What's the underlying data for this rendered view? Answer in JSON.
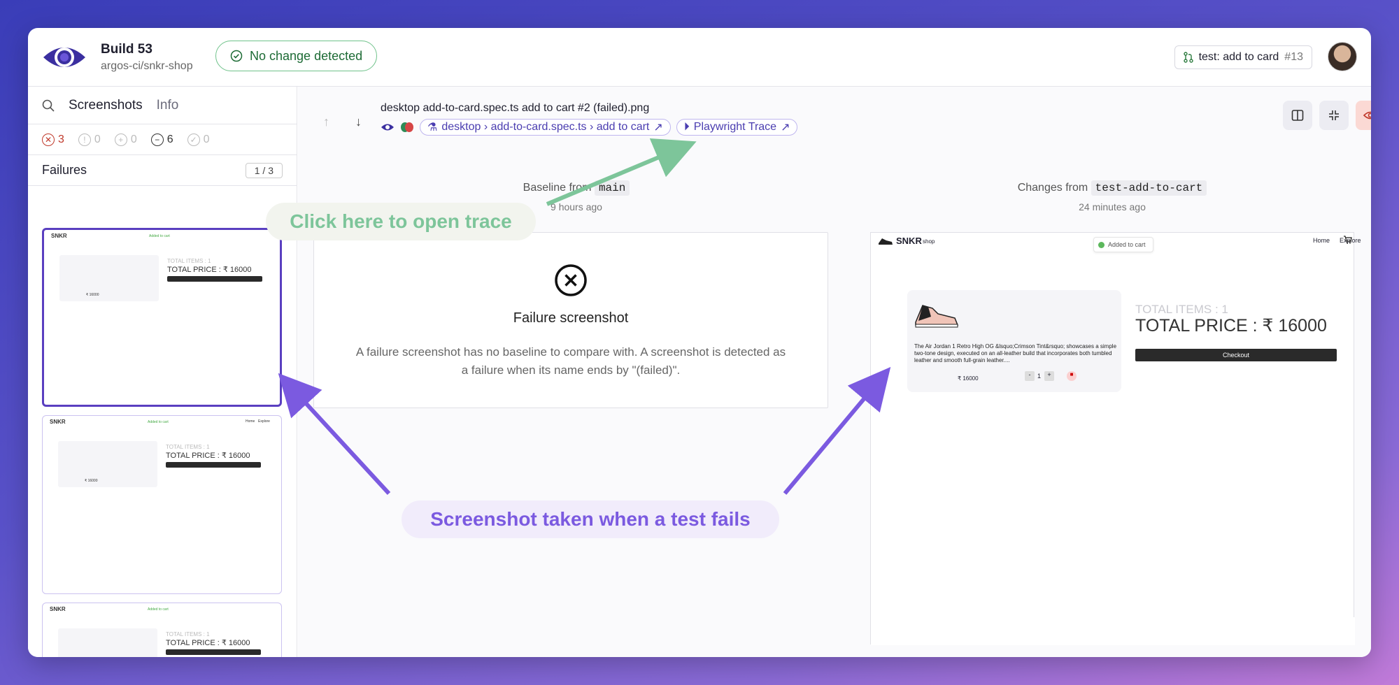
{
  "header": {
    "build_title": "Build 53",
    "repo": "argos-ci/snkr-shop",
    "status_label": "No change detected",
    "branch_label": "test: add to card",
    "pr_number": "#13"
  },
  "sidebar": {
    "tabs": [
      "Screenshots",
      "Info"
    ],
    "counts": {
      "failed": "3",
      "warning": "0",
      "added": "0",
      "unchanged": "6",
      "ok": "0"
    },
    "section_title": "Failures",
    "pager": "1 / 3",
    "thumb": {
      "brand": "SNKR",
      "brand_suffix": "shop",
      "toast": "Added to cart",
      "nav_home": "Home",
      "nav_explore": "Explore",
      "items": "TOTAL ITEMS : 1",
      "price": "TOTAL PRICE : ₹ 16000",
      "checkout": "Checkout",
      "product_price": "₹ 16000"
    }
  },
  "main": {
    "filename": "desktop add-to-card.spec.ts add to cart #2 (failed).png",
    "test_path": "desktop › add-to-card.spec.ts › add to cart",
    "trace_label": "Playwright Trace",
    "baseline": {
      "label": "Baseline from",
      "branch": "main",
      "time": "9 hours ago"
    },
    "changes": {
      "label": "Changes from",
      "branch": "test-add-to-cart",
      "time": "24 minutes ago"
    },
    "failure": {
      "title": "Failure screenshot",
      "description": "A failure screenshot has no baseline to compare with. A screenshot is detected as a failure when its name ends by \"(failed)\"."
    },
    "preview": {
      "brand": "SNKR",
      "brand_suffix": "shop",
      "toast": "Added to cart",
      "nav_home": "Home",
      "nav_explore": "Explore",
      "items": "TOTAL ITEMS : 1",
      "price": "TOTAL PRICE : ₹ 16000",
      "checkout": "Checkout",
      "product_desc": "The Air Jordan 1 Retro High OG &lsquo;Crimson Tint&rsquo; showcases a simple two-tone design, executed on an all-leather build that incorporates both tumbled leather and smooth full-grain leather....",
      "product_price": "₹ 16000",
      "qty": "1"
    }
  },
  "annotations": {
    "trace": "Click here to open trace",
    "failure": "Screenshot taken when a test fails"
  },
  "colors": {
    "accent": "#5a3fc0",
    "success": "#6fc28a",
    "failure": "#c0392b",
    "annot_green": "#7dc59a",
    "annot_purple": "#7b5ae0"
  }
}
